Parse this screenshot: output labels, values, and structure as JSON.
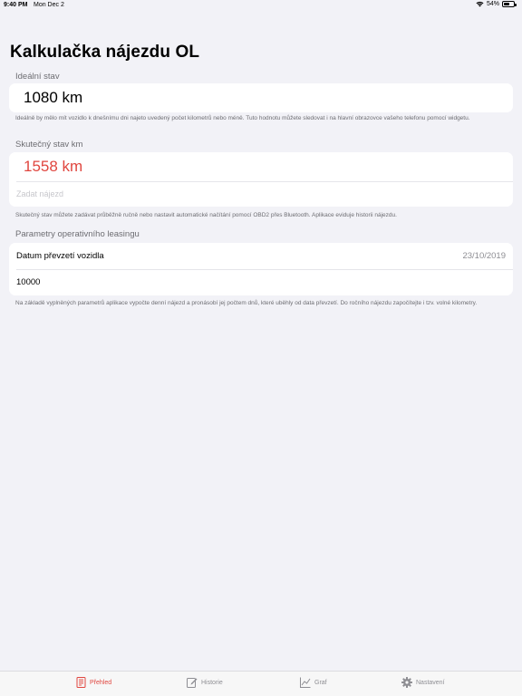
{
  "status": {
    "time": "9:40 PM",
    "date": "Mon Dec 2",
    "battery": "54%"
  },
  "title": "Kalkulačka nájezdu OL",
  "ideal": {
    "header": "Ideální stav",
    "value": "1080 km",
    "note": "Ideálně by mělo mít vozidlo k dnešnímu dni najeto uvedený počet kilometrů nebo méně. Tuto hodnotu můžete sledovat i na hlavní obrazovce vašeho telefonu pomocí widgetu."
  },
  "actual": {
    "header": "Skutečný stav km",
    "value": "1558 km",
    "input_placeholder": "Zadat nájezd",
    "note": "Skutečný stav můžete zadávat průběžně ručně nebo nastavit automatické načítání pomocí OBD2 přes Bluetooth. Aplikace eviduje historii nájezdu."
  },
  "leasing": {
    "header": "Parametry operativního leasingu",
    "date_label": "Datum převzetí vozidla",
    "date_value": "23/10/2019",
    "km_value": "10000",
    "note": "Na základě vyplněných parametrů aplikace vypočte denní nájezd a pronásobí jej počtem dnů, které uběhly od data převzetí. Do ročního nájezdu započítejte i tzv. volné kilometry."
  },
  "colors": {
    "accent": "#e0463f",
    "inactive": "#8e8e93"
  },
  "tabs": [
    {
      "label": "Přehled",
      "icon": "document-icon",
      "active": true
    },
    {
      "label": "Historie",
      "icon": "edit-icon",
      "active": false
    },
    {
      "label": "Graf",
      "icon": "chart-icon",
      "active": false
    },
    {
      "label": "Nastavení",
      "icon": "gear-icon",
      "active": false
    }
  ]
}
